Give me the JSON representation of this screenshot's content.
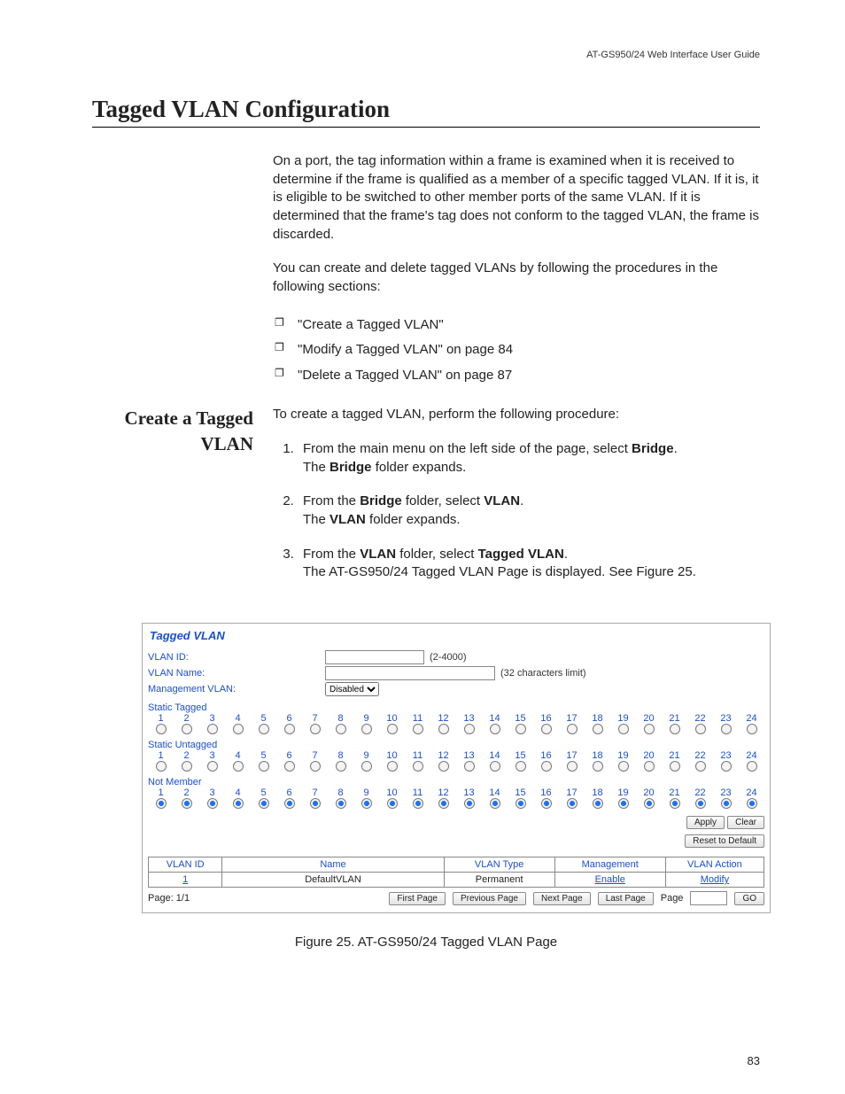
{
  "header": {
    "running": "AT-GS950/24  Web Interface User Guide"
  },
  "title": "Tagged VLAN Configuration",
  "intro1": "On a port, the tag information within a frame is examined when it is received to determine if the frame is qualified as a member of a specific tagged VLAN. If it is, it is eligible to be switched to other member ports of the same VLAN. If it is determined that the frame's tag does not conform to the tagged VLAN, the frame is discarded.",
  "intro2": "You can create and delete tagged VLANs by following the procedures in the following sections:",
  "bullets": [
    "\"Create a Tagged VLAN\"",
    "\"Modify a Tagged VLAN\" on page 84",
    "\"Delete a Tagged VLAN\" on page 87"
  ],
  "side_heading": "Create a Tagged VLAN",
  "proc_intro": "To create a tagged VLAN, perform the following procedure:",
  "steps": {
    "s1a": "From the main menu on the left side of the page, select ",
    "s1b": "Bridge",
    "s1c": ".",
    "s1d": "The ",
    "s1e": "Bridge",
    "s1f": " folder expands.",
    "s2a": "From the ",
    "s2b": "Bridge",
    "s2c": " folder, select ",
    "s2d": "VLAN",
    "s2e": ".",
    "s2f": "The ",
    "s2g": "VLAN",
    "s2h": " folder expands.",
    "s3a": "From the ",
    "s3b": "VLAN",
    "s3c": " folder, select ",
    "s3d": "Tagged VLAN",
    "s3e": ".",
    "s3f": "The AT-GS950/24 Tagged VLAN Page is displayed. See Figure 25."
  },
  "figure": {
    "title": "Tagged VLAN",
    "vlan_id_label": "VLAN ID:",
    "vlan_id_hint": "(2-4000)",
    "vlan_name_label": "VLAN Name:",
    "vlan_name_hint": "(32 characters limit)",
    "mgmt_label": "Management VLAN:",
    "mgmt_value": "Disabled",
    "section_tagged": "Static Tagged",
    "section_untagged": "Static Untagged",
    "section_notmember": "Not Member",
    "apply": "Apply",
    "clear": "Clear",
    "reset": "Reset to Default",
    "table": {
      "h_id": "VLAN ID",
      "h_name": "Name",
      "h_type": "VLAN Type",
      "h_mgmt": "Management",
      "h_action": "VLAN Action",
      "r_id": "1",
      "r_name": "DefaultVLAN",
      "r_type": "Permanent",
      "r_mgmt": "Enable",
      "r_action": "Modify"
    },
    "pager": {
      "page_label": "Page: 1/1",
      "first": "First Page",
      "prev": "Previous Page",
      "next": "Next Page",
      "last": "Last Page",
      "page_word": "Page",
      "go": "GO"
    }
  },
  "figure_caption": "Figure 25. AT-GS950/24 Tagged VLAN Page",
  "page_number": "83"
}
